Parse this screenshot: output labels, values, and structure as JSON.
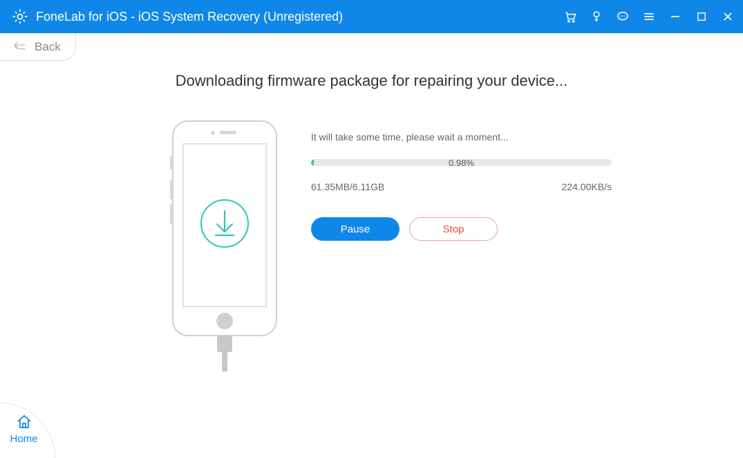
{
  "titlebar": {
    "title": "FoneLab for iOS - iOS System Recovery (Unregistered)"
  },
  "back": {
    "label": "Back"
  },
  "main": {
    "heading": "Downloading firmware package for repairing your device...",
    "wait_text": "It will take some time, please wait a moment...",
    "progress": {
      "percent": 0.98,
      "percent_label": "0.98%",
      "downloaded": "61.35MB/6.11GB",
      "speed": "224.00KB/s"
    },
    "buttons": {
      "pause": "Pause",
      "stop": "Stop"
    }
  },
  "home": {
    "label": "Home"
  },
  "colors": {
    "brand": "#0f87e8",
    "accent": "#2fc7b3",
    "danger": "#e44a4a"
  }
}
